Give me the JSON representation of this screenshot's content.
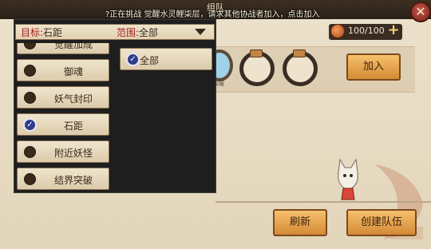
{
  "header": {
    "title": "组队",
    "broadcast": "?正在挑战 觉醒水灵鲤柒层，请求其他协战者加入，点击加入"
  },
  "resource": {
    "value": "100/100",
    "plus": "+"
  },
  "filter": {
    "target_label": "目标:",
    "target_value": "石距",
    "range_label": "范围:",
    "range_value": "全部"
  },
  "targets": [
    {
      "label": "觉醒加成",
      "checked": false
    },
    {
      "label": "御魂",
      "checked": false
    },
    {
      "label": "妖气封印",
      "checked": false
    },
    {
      "label": "石距",
      "checked": true
    },
    {
      "label": "附近妖怪",
      "checked": false
    },
    {
      "label": "结界突破",
      "checked": false
    }
  ],
  "ranges": [
    {
      "label": "全部",
      "checked": true
    }
  ],
  "team": {
    "lead_caption": "觉醒水灵鲤柒层"
  },
  "buttons": {
    "join": "加入",
    "refresh": "刷新",
    "create_team": "创建队伍"
  },
  "icons": {
    "close": "close-icon",
    "resource": "stamina-icon",
    "check": "check-icon",
    "chevron": "chevron-down-icon"
  },
  "colors": {
    "accent_red": "#a3211a",
    "button_gold": "#e4a04e",
    "check_blue": "#2f3c8a"
  }
}
